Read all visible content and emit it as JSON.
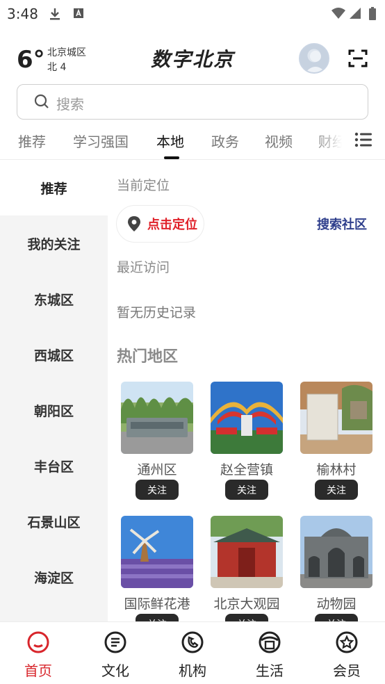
{
  "status_bar": {
    "time": "3:48"
  },
  "weather": {
    "temperature": "6°",
    "district": "北京城区",
    "wind": "北 4"
  },
  "app": {
    "logo_text": "数字北京"
  },
  "search": {
    "placeholder": "搜索"
  },
  "tabs": [
    {
      "label": "推荐",
      "active": false
    },
    {
      "label": "学习强国",
      "active": false
    },
    {
      "label": "本地",
      "active": true
    },
    {
      "label": "政务",
      "active": false
    },
    {
      "label": "视频",
      "active": false
    },
    {
      "label": "财经",
      "active": false
    }
  ],
  "sidebar": {
    "items": [
      {
        "label": "推荐",
        "active": true
      },
      {
        "label": "我的关注",
        "active": false
      },
      {
        "label": "东城区",
        "active": false
      },
      {
        "label": "西城区",
        "active": false
      },
      {
        "label": "朝阳区",
        "active": false
      },
      {
        "label": "丰台区",
        "active": false
      },
      {
        "label": "石景山区",
        "active": false
      },
      {
        "label": "海淀区",
        "active": false
      }
    ]
  },
  "content": {
    "current_location_label": "当前定位",
    "locate_button": "点击定位",
    "search_community": "搜索社区",
    "recent_label": "最近访问",
    "no_history": "暂无历史记录",
    "hot_title": "热门地区",
    "follow_label": "关注",
    "places": [
      {
        "name": "通州区"
      },
      {
        "name": "赵全营镇"
      },
      {
        "name": "榆林村"
      },
      {
        "name": "国际鲜花港"
      },
      {
        "name": "北京大观园"
      },
      {
        "name": "动物园"
      }
    ]
  },
  "bottom_nav": [
    {
      "label": "首页",
      "icon": "home-icon",
      "active": true
    },
    {
      "label": "文化",
      "icon": "culture-icon",
      "active": false
    },
    {
      "label": "机构",
      "icon": "institution-icon",
      "active": false
    },
    {
      "label": "生活",
      "icon": "life-icon",
      "active": false
    },
    {
      "label": "会员",
      "icon": "member-icon",
      "active": false
    }
  ],
  "colors": {
    "accent_red": "#e0222a",
    "nav_active": "#d8252b",
    "link_blue": "#2f3f8c"
  }
}
